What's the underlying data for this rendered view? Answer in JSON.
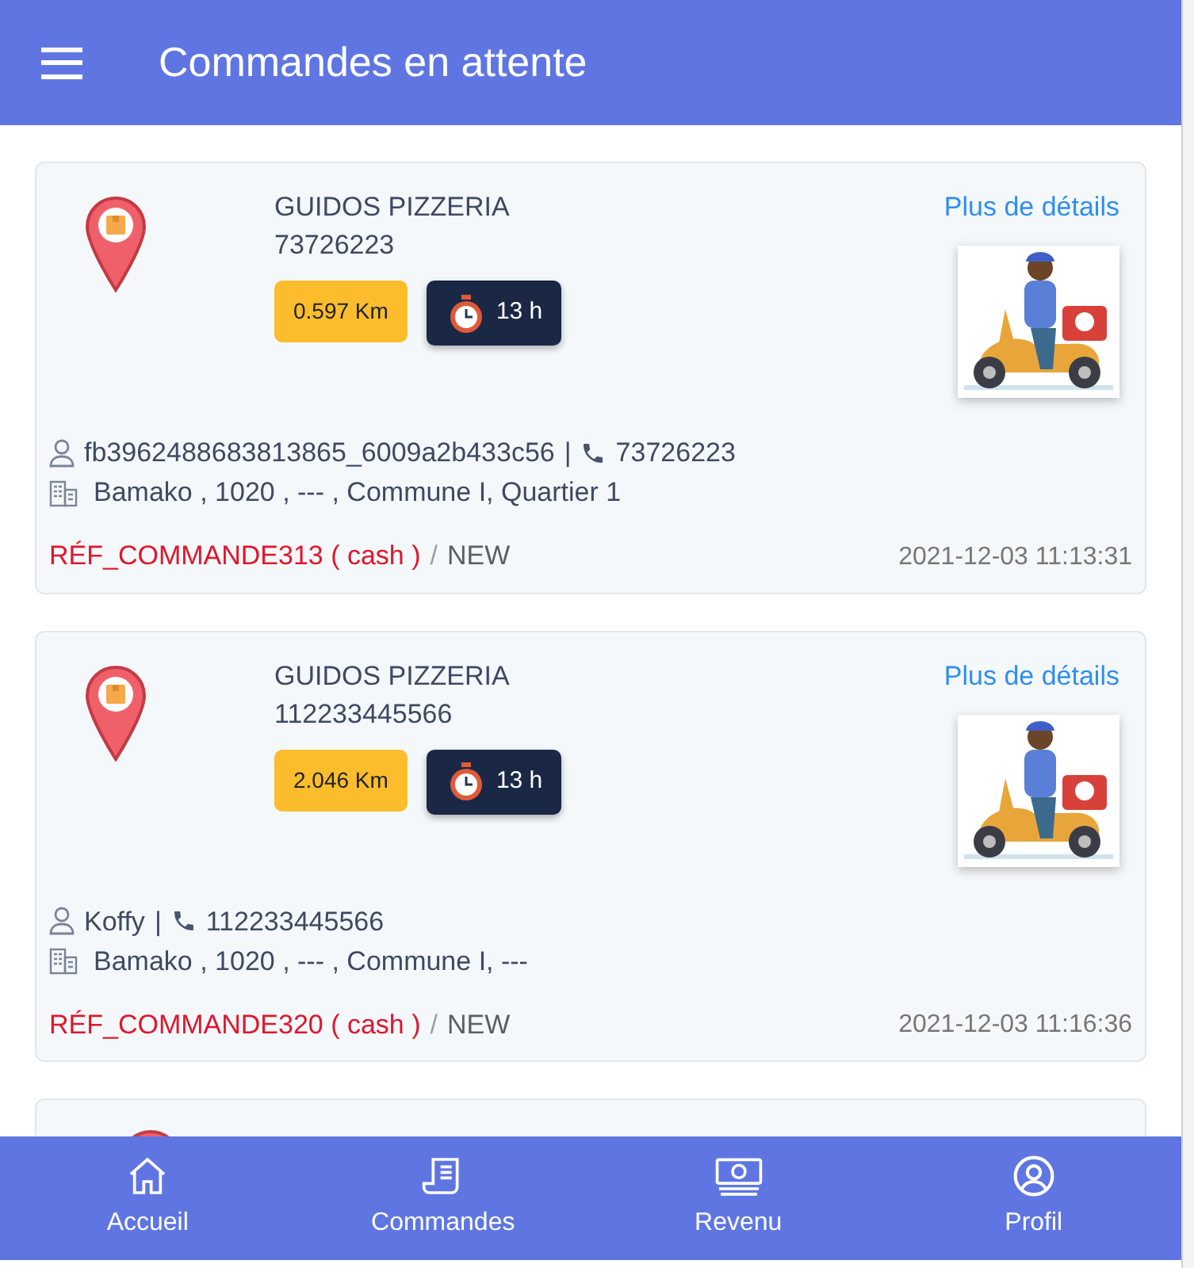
{
  "header": {
    "title": "Commandes en attente"
  },
  "orders": [
    {
      "restaurant": "GUIDOS PIZZERIA",
      "phone": "73726223",
      "distance": "0.597 Km",
      "duration": "13 h",
      "details_link": "Plus de détails",
      "customer": "fb3962488683813865_6009a2b433c56",
      "separator": "|",
      "customer_phone": "73726223",
      "address": "Bamako , 1020 , --- , Commune I, Quartier 1",
      "reference": "RÉF_COMMANDE313 ( cash )",
      "slash": "/",
      "status": "NEW",
      "date": "2021-12-03 11:13:31"
    },
    {
      "restaurant": "GUIDOS PIZZERIA",
      "phone": "112233445566",
      "distance": "2.046 Km",
      "duration": "13 h",
      "details_link": "Plus de détails",
      "customer": "Koffy",
      "separator": "|",
      "customer_phone": "112233445566",
      "address": "Bamako , 1020 , --- , Commune I, ---",
      "reference": "RÉF_COMMANDE320 ( cash )",
      "slash": "/",
      "status": "NEW",
      "date": "2021-12-03 11:16:36"
    }
  ],
  "nav": [
    {
      "label": "Accueil"
    },
    {
      "label": "Commandes"
    },
    {
      "label": "Revenu"
    },
    {
      "label": "Profil"
    }
  ]
}
